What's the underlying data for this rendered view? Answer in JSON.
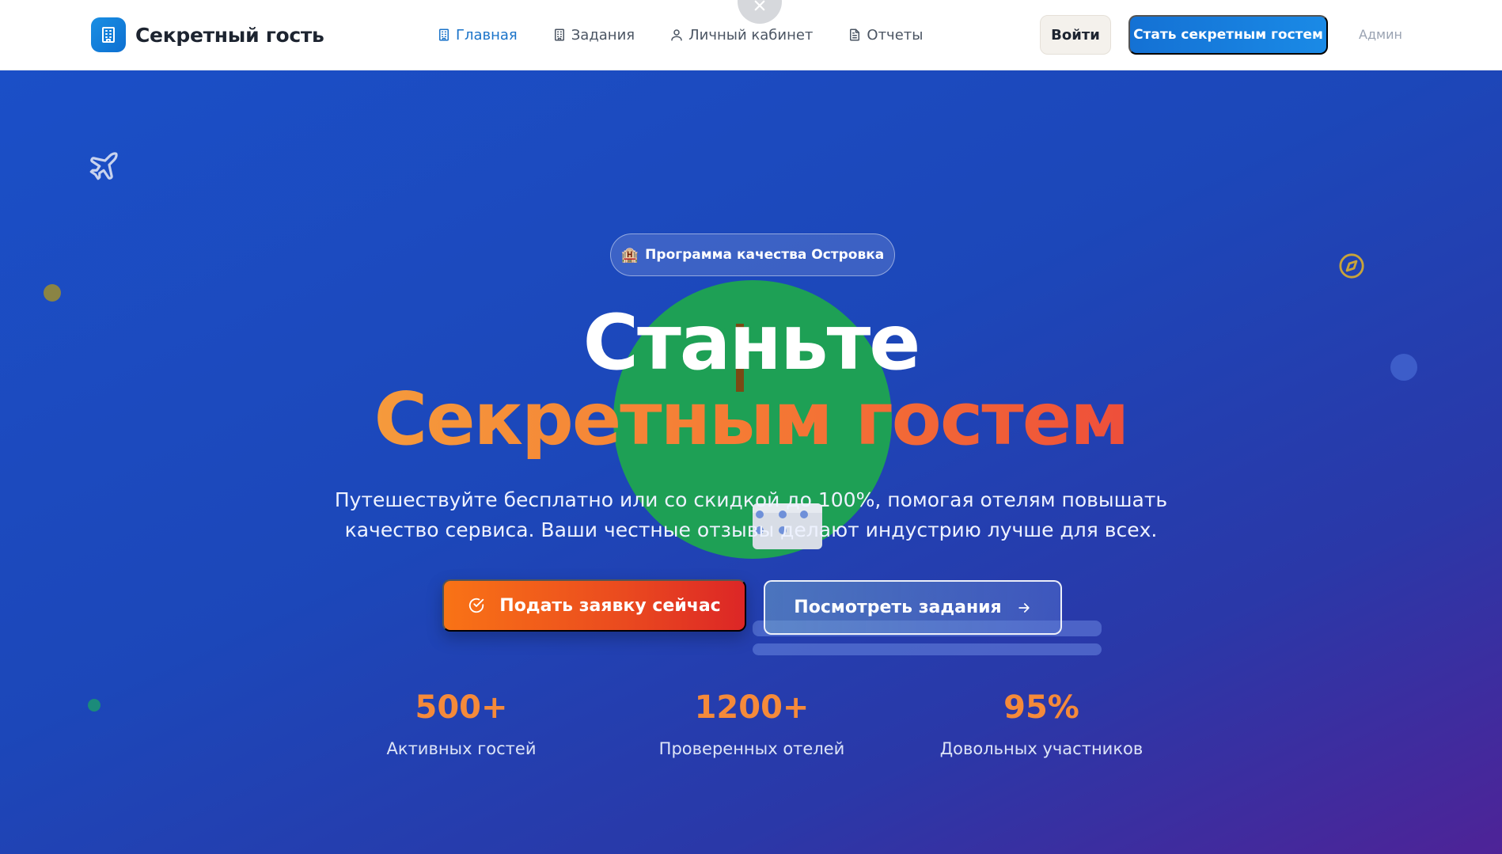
{
  "brand": {
    "name": "Секретный гость",
    "logo_icon": "building-icon",
    "logo_color": "#1a8fe3"
  },
  "nav": {
    "items": [
      {
        "label": "Главная",
        "icon": "building-icon",
        "active": true
      },
      {
        "label": "Задания",
        "icon": "building-icon",
        "active": false
      },
      {
        "label": "Личный кабинет",
        "icon": "user-icon",
        "active": false
      },
      {
        "label": "Отчеты",
        "icon": "document-icon",
        "active": false
      }
    ],
    "login_label": "Войти",
    "become_label": "Стать секретным гостем",
    "admin_label": "Админ"
  },
  "hero": {
    "badge_icon": "🏨",
    "badge_text": "Программа качества Островка",
    "title_line1": "Станьте",
    "title_line2": "Секретным гостем",
    "subtitle_line1": "Путешествуйте бесплатно или со скидкой до 100%, помогая отелям повышать",
    "subtitle_line2": "качество сервиса. Ваши честные отзывы делают индустрию лучше для всех.",
    "apply_label": "Подать заявку сейчас",
    "tasks_label": "Посмотреть задания",
    "stats": [
      {
        "value": "500+",
        "label": "Активных гостей"
      },
      {
        "value": "1200+",
        "label": "Проверенных отелей"
      },
      {
        "value": "95%",
        "label": "Довольных участников"
      }
    ]
  },
  "colors": {
    "primary": "#1471d4",
    "accent_orange": "#f97316",
    "accent_red": "#dc2626",
    "hero_bg_start": "#1b4fc7",
    "hero_bg_end": "#4e2397",
    "stat_value": "#f58a3a"
  }
}
